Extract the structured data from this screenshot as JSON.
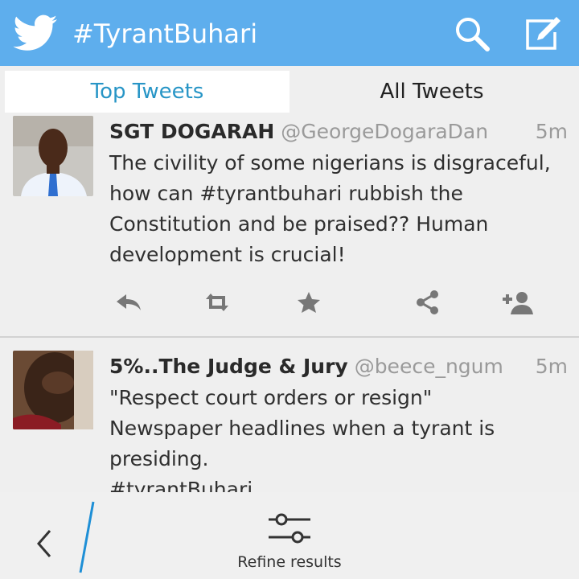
{
  "header": {
    "title": "#TyrantBuhari",
    "brand_icon": "twitter-bird-icon",
    "search_icon": "search-icon",
    "compose_icon": "compose-icon",
    "background": "#5eaeed"
  },
  "tabs": [
    {
      "label": "Top Tweets",
      "selected": true,
      "color": "#2795c6"
    },
    {
      "label": "All Tweets",
      "selected": false
    }
  ],
  "tweets": [
    {
      "name": "SGT DOGARAH",
      "handle": "@GeorgeDogaraDan",
      "time": "5m",
      "text": "The civility of some nigerians is disgraceful,\nhow can #tyrantbuhari rubbish the\nConstitution and be praised?? Human\ndevelopment is crucial!",
      "actions": [
        "reply-icon",
        "retweet-icon",
        "favorite-star-icon",
        "share-icon",
        "follow-user-icon"
      ]
    },
    {
      "name": "5%..The Judge & Jury",
      "handle": "@beece_ngum",
      "time": "5m",
      "text": "\"Respect court orders or resign\"\nNewspaper headlines when a tyrant is\npresiding.\n#tyrantBuhari"
    }
  ],
  "bottom_bar": {
    "back_icon": "chevron-left-icon",
    "refine_label": "Refine results",
    "refine_icon": "sliders-icon"
  }
}
